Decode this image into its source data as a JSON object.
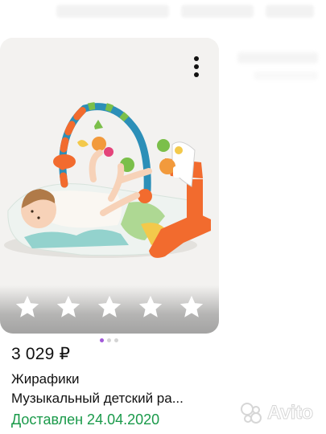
{
  "listing": {
    "price": "3 029 ₽",
    "seller": "Жирафики",
    "title": "Музыкальный детский ра...",
    "status": "Доставлен 24.04.2020",
    "rating_stars_total": 5,
    "rating_stars_filled": 0,
    "image_pages_total": 3,
    "image_page_active": 1
  },
  "watermark": {
    "text": "Avito"
  },
  "colors": {
    "status_green": "#1a9a4a",
    "pager_active": "#a259d9",
    "pager_inactive": "#d4d4d4",
    "card_background": "#f3f2f0"
  },
  "icons": {
    "menu": "more-vertical-icon",
    "star": "star-icon",
    "watermark": "avito-logo-icon"
  }
}
